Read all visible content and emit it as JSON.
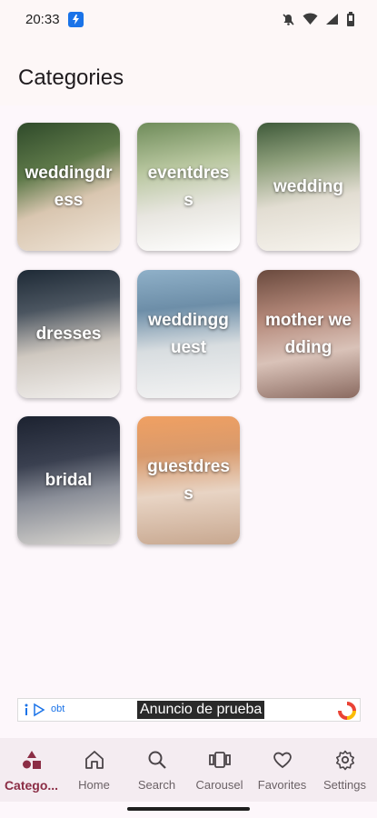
{
  "status_bar": {
    "time": "20:33"
  },
  "header": {
    "title": "Categories"
  },
  "categories": [
    {
      "label": "weddingdress"
    },
    {
      "label": "eventdress"
    },
    {
      "label": "wedding"
    },
    {
      "label": "dresses"
    },
    {
      "label": "weddingguest"
    },
    {
      "label": "mother wedding"
    },
    {
      "label": "bridal"
    },
    {
      "label": "guestdress"
    }
  ],
  "ad": {
    "text": "Anuncio de prueba",
    "info_label": "obt"
  },
  "bottom_nav": {
    "items": [
      {
        "label": "Catego...",
        "icon": "categories-icon"
      },
      {
        "label": "Home",
        "icon": "home-icon"
      },
      {
        "label": "Search",
        "icon": "search-icon"
      },
      {
        "label": "Carousel",
        "icon": "carousel-icon"
      },
      {
        "label": "Favorites",
        "icon": "heart-icon"
      },
      {
        "label": "Settings",
        "icon": "gear-icon"
      }
    ]
  },
  "colors": {
    "accent": "#8b2d45",
    "background": "#fdf7fb",
    "nav_background": "#f4ecf1"
  }
}
